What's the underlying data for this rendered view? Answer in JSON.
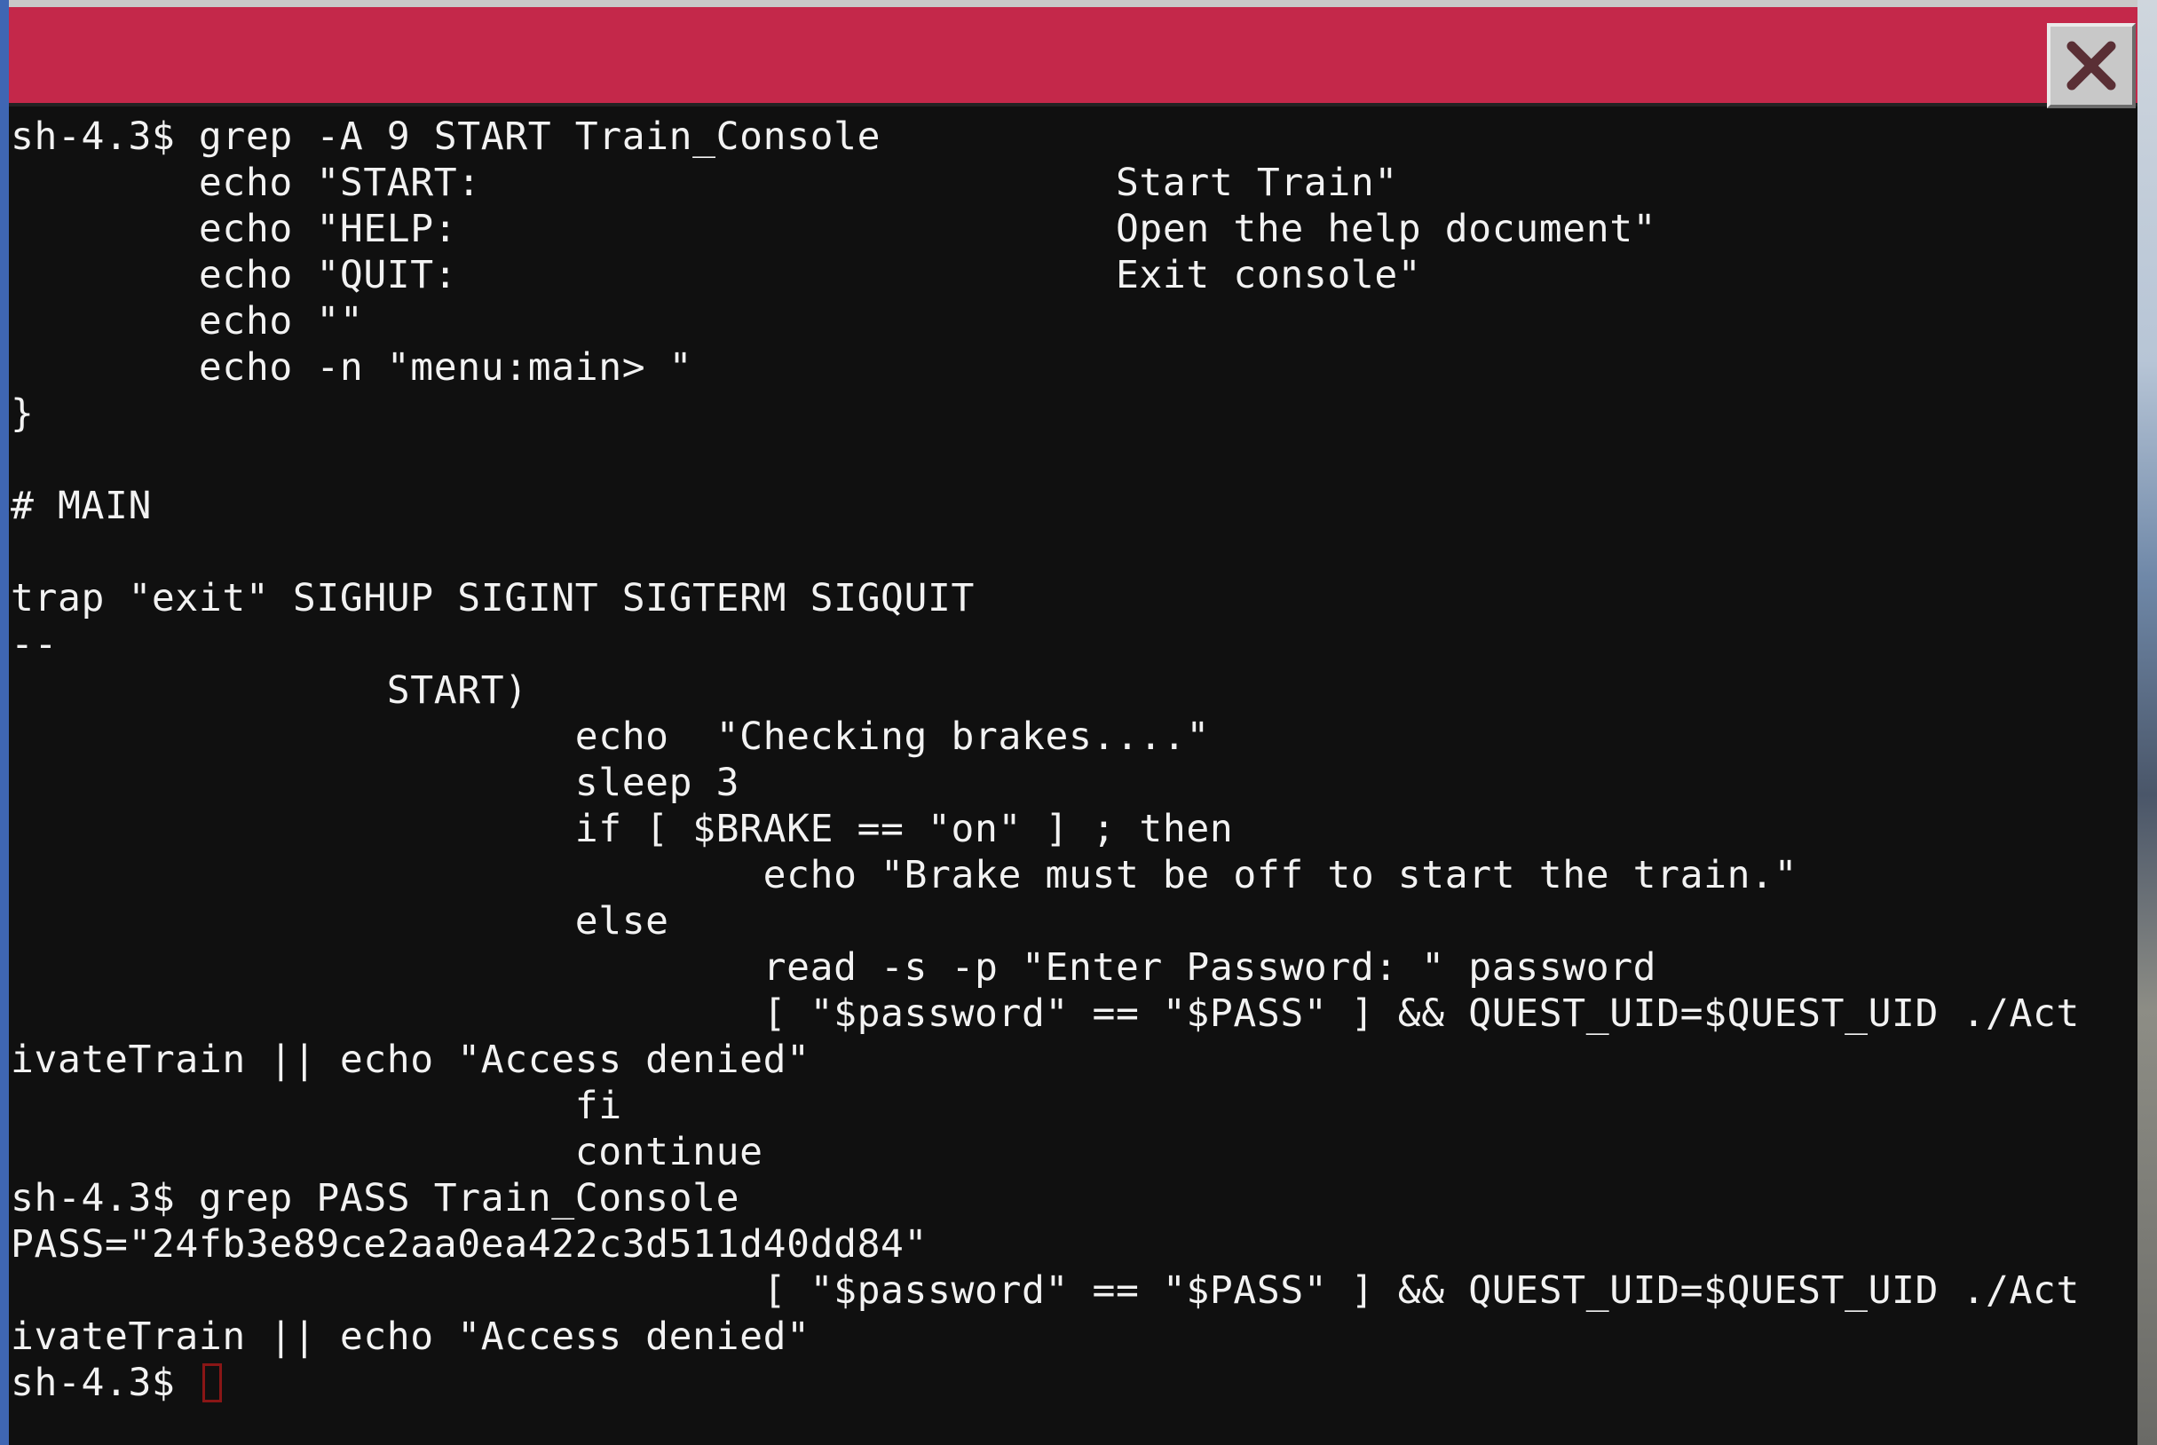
{
  "window": {
    "title": "",
    "close_icon": "close-icon",
    "accent_color": "#c4284a"
  },
  "terminal": {
    "lines": [
      "sh-4.3$ grep -A 9 START Train_Console",
      "        echo \"START:                           Start Train\"",
      "        echo \"HELP:                            Open the help document\"",
      "        echo \"QUIT:                            Exit console\"",
      "        echo \"\"",
      "        echo -n \"menu:main> \"",
      "}",
      "",
      "# MAIN",
      "",
      "trap \"exit\" SIGHUP SIGINT SIGTERM SIGQUIT",
      "--",
      "                START)",
      "                        echo  \"Checking brakes....\"",
      "                        sleep 3",
      "                        if [ $BRAKE == \"on\" ] ; then",
      "                                echo \"Brake must be off to start the train.\"",
      "                        else",
      "                                read -s -p \"Enter Password: \" password",
      "                                [ \"$password\" == \"$PASS\" ] && QUEST_UID=$QUEST_UID ./Act",
      "ivateTrain || echo \"Access denied\"",
      "                        fi",
      "                        continue",
      "sh-4.3$ grep PASS Train_Console",
      "PASS=\"24fb3e89ce2aa0ea422c3d511d40dd84\"",
      "                                [ \"$password\" == \"$PASS\" ] && QUEST_UID=$QUEST_UID ./Act",
      "ivateTrain || echo \"Access denied\""
    ],
    "prompt": "sh-4.3$ "
  }
}
